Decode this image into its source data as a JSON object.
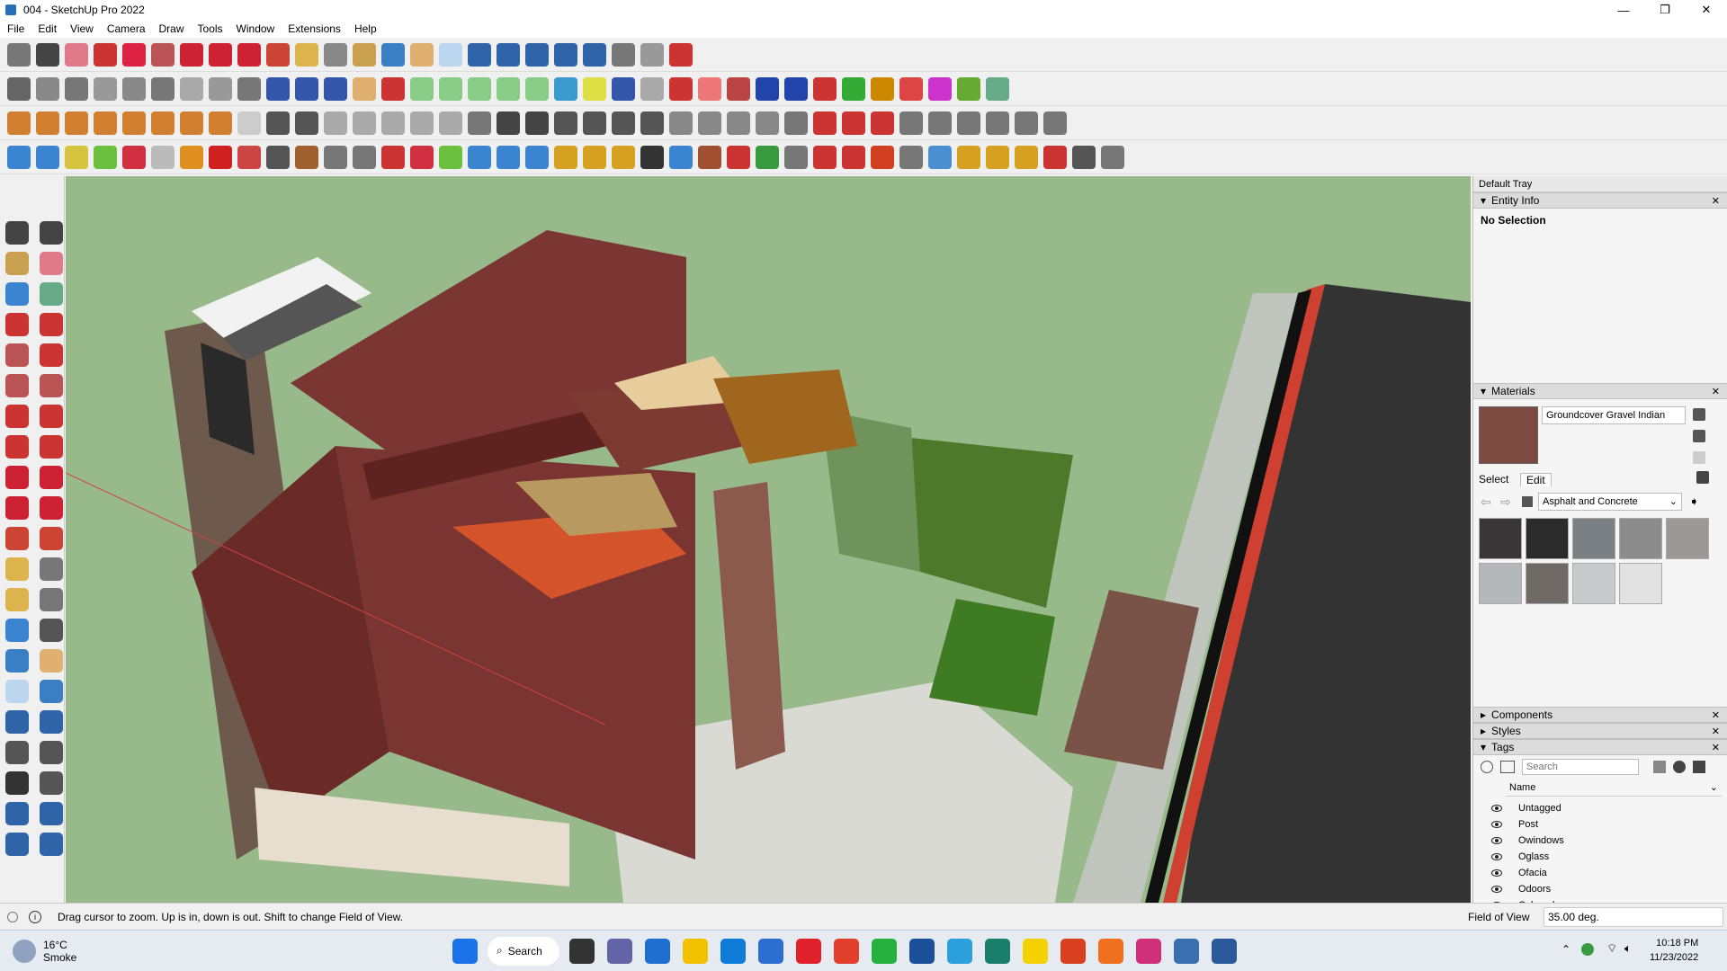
{
  "window": {
    "title": "004 - SketchUp Pro 2022",
    "minimize": "—",
    "maximize": "❐",
    "close": "✕"
  },
  "menu": [
    "File",
    "Edit",
    "View",
    "Camera",
    "Draw",
    "Tools",
    "Window",
    "Extensions",
    "Help"
  ],
  "tray": {
    "title": "Default Tray",
    "entity_info": {
      "header": "Entity Info",
      "selection": "No Selection"
    },
    "materials": {
      "header": "Materials",
      "current_material": "Groundcover Gravel Indian",
      "tab_select": "Select",
      "tab_edit": "Edit",
      "library": "Asphalt and Concrete",
      "swatch_colors": [
        "#3a3536",
        "#2b2b2b",
        "#7b8084",
        "#8c8c8c",
        "#9b9898",
        "#b5b8b8",
        "#706a66",
        "#c8cacb",
        "#e2e2e2"
      ]
    },
    "components": {
      "header": "Components"
    },
    "styles": {
      "header": "Styles"
    },
    "tags": {
      "header": "Tags",
      "search_placeholder": "Search",
      "column_name": "Name",
      "items": [
        "Untagged",
        "Post",
        "Owindows",
        "Oglass",
        "Ofacia",
        "Odoors",
        "Oclosed"
      ]
    }
  },
  "status": {
    "message": "Drag cursor to zoom.  Up is in, down is out. Shift to change Field of View.",
    "measure_label": "Field of View",
    "measure_value": "35.00 deg."
  },
  "taskbar": {
    "weather_temp": "16°C",
    "weather_desc": "Smoke",
    "search_label": "Search",
    "time": "10:18 PM",
    "date": "11/23/2022"
  }
}
